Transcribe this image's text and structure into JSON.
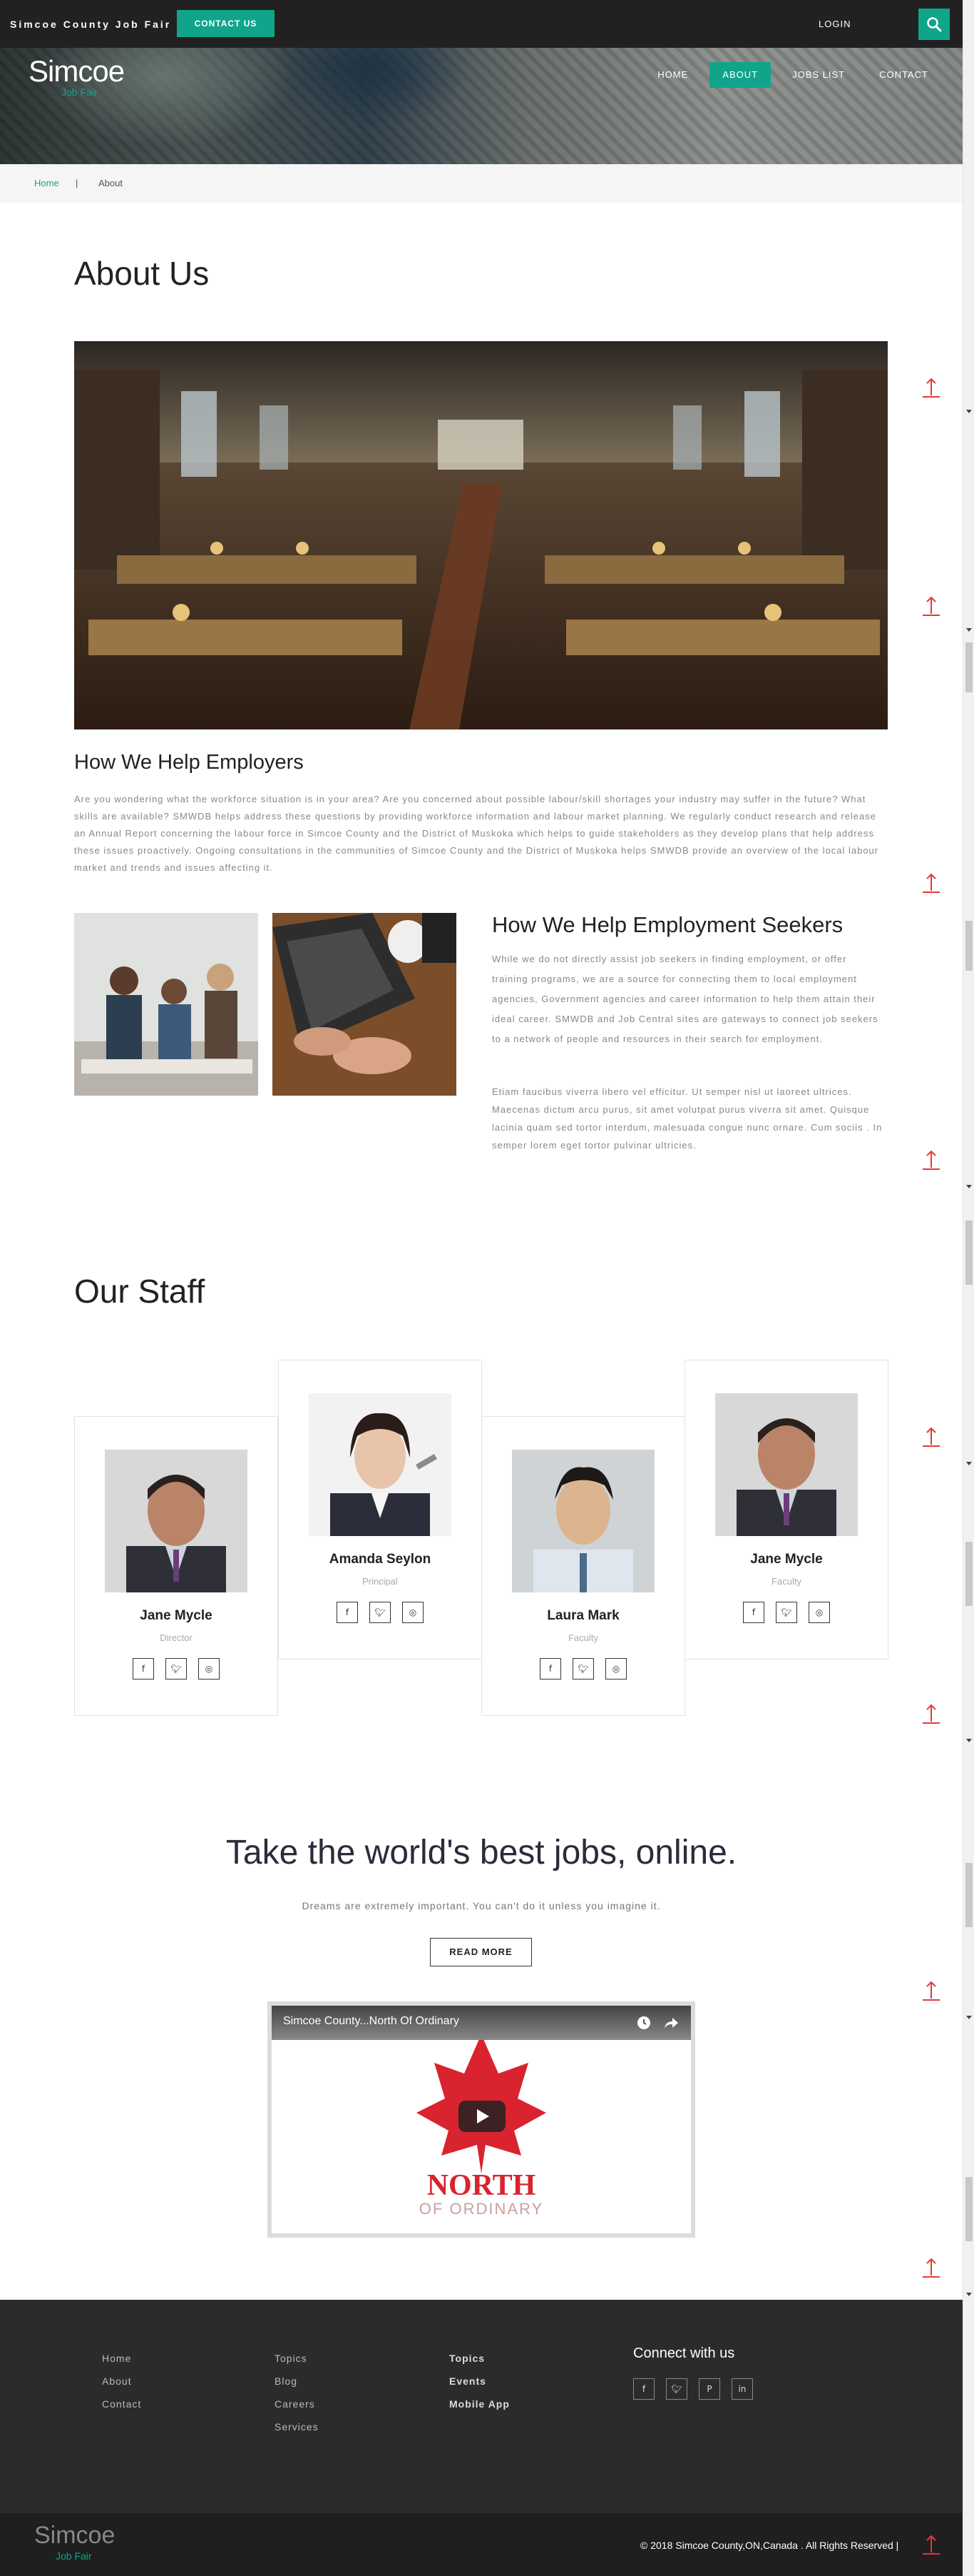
{
  "topbar": {
    "brand": "Simcoe County Job Fair",
    "contact_label": "CONTACT US",
    "login_label": "LOGIN"
  },
  "hero": {
    "logo_main": "Simcoe",
    "logo_sub": "Job Fair",
    "nav": [
      "HOME",
      "ABOUT",
      "JOBS LIST",
      "CONTACT"
    ],
    "active_nav": "ABOUT"
  },
  "breadcrumb": {
    "home": "Home",
    "separator": "|",
    "current": "About"
  },
  "about": {
    "title": "About Us",
    "employers_title": "How We Help Employers",
    "employers_text": "Are you wondering what the workforce situation is in your area? Are you concerned about possible labour/skill shortages your industry may suffer in the future? What skills are available? SMWDB helps address these questions by providing workforce information and labour market planning. We regularly conduct research and release an Annual Report concerning the labour force in Simcoe County and the District of Muskoka which helps to guide stakeholders as they develop plans that help address these issues proactively. Ongoing consultations in the communities of Simcoe County and the District of Muskoka helps SMWDB provide an overview of the local labour market and trends and issues affecting it.",
    "seekers_title": "How We Help Employment Seekers",
    "seekers_text_1": "While we do not directly assist job seekers in finding employment, or offer training programs, we are a source for connecting them to local employment agencies, Government agencies and career information to help them attain their ideal career. SMWDB and Job Central sites are gateways to connect job seekers to a network of people and resources in their search for employment.",
    "seekers_text_2": "Etiam faucibus viverra libero vel efficitur. Ut semper nisl ut laoreet ultrices. Maecenas dictum arcu purus, sit amet volutpat purus viverra sit amet. Quisque lacinia quam sed tortor interdum, malesuada congue nunc ornare. Cum sociis . In semper lorem eget tortor pulvinar ultricies."
  },
  "staff": {
    "title": "Our Staff",
    "members": [
      {
        "name": "Jane Mycle",
        "role": "Director"
      },
      {
        "name": "Amanda Seylon",
        "role": "Principal"
      },
      {
        "name": "Laura Mark",
        "role": "Faculty"
      },
      {
        "name": "Jane Mycle",
        "role": "Faculty"
      }
    ],
    "social_icons": [
      "facebook-icon",
      "twitter-icon",
      "dribbble-icon"
    ]
  },
  "cta": {
    "title": "Take the world's best jobs, online.",
    "subtitle": "Dreams are extremely important. You can't do it unless you imagine it.",
    "button": "READ MORE"
  },
  "video": {
    "title": "Simcoe County...North Of Ordinary",
    "logo_line_1": "NORTH",
    "logo_line_2": "OF ORDINARY"
  },
  "footer": {
    "col1": [
      "Home",
      "About",
      "Contact"
    ],
    "col2": [
      "Topics",
      "Blog",
      "Careers",
      "Services"
    ],
    "col3": [
      "Topics",
      "Events",
      "Mobile App"
    ],
    "connect_title": "Connect with us",
    "social_icons": [
      "facebook-icon",
      "twitter-icon",
      "pinterest-icon",
      "linkedin-icon"
    ],
    "logo_main": "Simcoe",
    "logo_sub": "Job Fair",
    "copyright": "© 2018 Simcoe County,ON,Canada . All Rights Reserved |"
  },
  "colors": {
    "accent": "#10a58b",
    "dark": "#212121",
    "footer": "#2b2b2b",
    "back_to_top_arrow": "#e53935"
  }
}
